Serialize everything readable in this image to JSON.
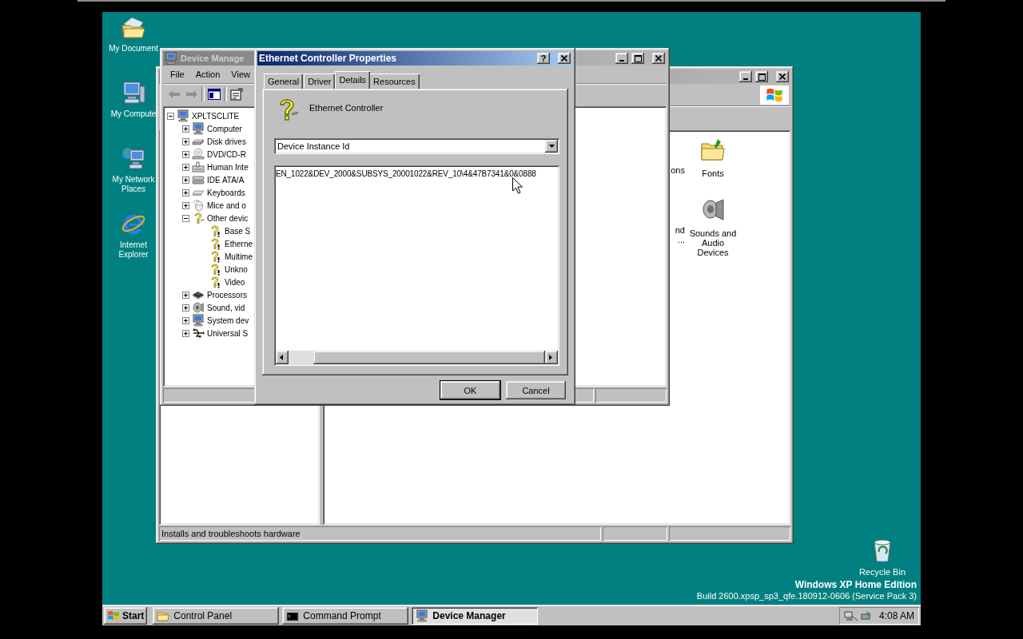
{
  "desktop": {
    "icons": [
      {
        "label": "My Document",
        "kind": "documents"
      },
      {
        "label": "My Compute",
        "kind": "computer"
      },
      {
        "label": "My Network Places",
        "kind": "network"
      },
      {
        "label": "Internet Explorer",
        "kind": "browser"
      }
    ],
    "recycle_bin": {
      "label": "Recycle Bin"
    },
    "edition": "Windows XP Home Edition",
    "build": "Build 2600.xpsp_sp3_qfe.180912-0606 (Service Pack 3)"
  },
  "control_panel": {
    "cut_labels": [
      {
        "lines": [
          "ons"
        ]
      },
      {
        "lines": [
          "nd",
          "..."
        ]
      }
    ],
    "items": [
      {
        "label": "Fonts",
        "kind": "fonts"
      },
      {
        "label": "Sounds and Audio Devices",
        "kind": "sounds"
      }
    ],
    "status_bar": "Installs and troubleshoots hardware"
  },
  "device_manager": {
    "title": "Device Manage",
    "menu": [
      "File",
      "Action",
      "View"
    ],
    "tree": {
      "label": "XPLTSCLITE",
      "expanded": true,
      "children": [
        {
          "label": "Computer",
          "kind": "computer",
          "expanded": false
        },
        {
          "label": "Disk drives",
          "kind": "disk",
          "expanded": false
        },
        {
          "label": "DVD/CD-R",
          "kind": "cd",
          "expanded": false
        },
        {
          "label": "Human Inte",
          "kind": "hid",
          "expanded": false
        },
        {
          "label": "IDE ATA/A",
          "kind": "ide",
          "expanded": false
        },
        {
          "label": "Keyboards",
          "kind": "keyboard",
          "expanded": false
        },
        {
          "label": "Mice and o",
          "kind": "mouse",
          "expanded": false
        },
        {
          "label": "Other devic",
          "kind": "unknown",
          "expanded": true,
          "children": [
            {
              "label": "Base S",
              "kind": "warning"
            },
            {
              "label": "Etherne",
              "kind": "warning"
            },
            {
              "label": "Multime",
              "kind": "warning"
            },
            {
              "label": "Unkno",
              "kind": "warning"
            },
            {
              "label": "Video",
              "kind": "warning"
            }
          ]
        },
        {
          "label": "Processors",
          "kind": "chip",
          "expanded": false
        },
        {
          "label": "Sound, vid",
          "kind": "speaker",
          "expanded": false
        },
        {
          "label": "System dev",
          "kind": "computer",
          "expanded": false
        },
        {
          "label": "Universal S",
          "kind": "usb",
          "expanded": false
        }
      ]
    }
  },
  "dialog": {
    "title": "Ethernet Controller Properties",
    "help_button": "?",
    "tabs": [
      {
        "label": "General",
        "selected": false
      },
      {
        "label": "Driver",
        "selected": false
      },
      {
        "label": "Details",
        "selected": true
      },
      {
        "label": "Resources",
        "selected": false
      }
    ],
    "device_name": "Ethernet Controller",
    "property": "Device Instance Id",
    "value": "EN_1022&DEV_2000&SUBSYS_20001022&REV_10\\4&47B7341&0&0888",
    "buttons": [
      "OK",
      "Cancel"
    ]
  },
  "taskbar": {
    "start": "Start",
    "tasks": [
      {
        "label": "Control Panel",
        "kind": "folder",
        "selected": false
      },
      {
        "label": "Command Prompt",
        "kind": "console",
        "selected": false
      },
      {
        "label": "Device Manager",
        "kind": "computer",
        "selected": true
      }
    ],
    "clock": "4:08 AM"
  }
}
